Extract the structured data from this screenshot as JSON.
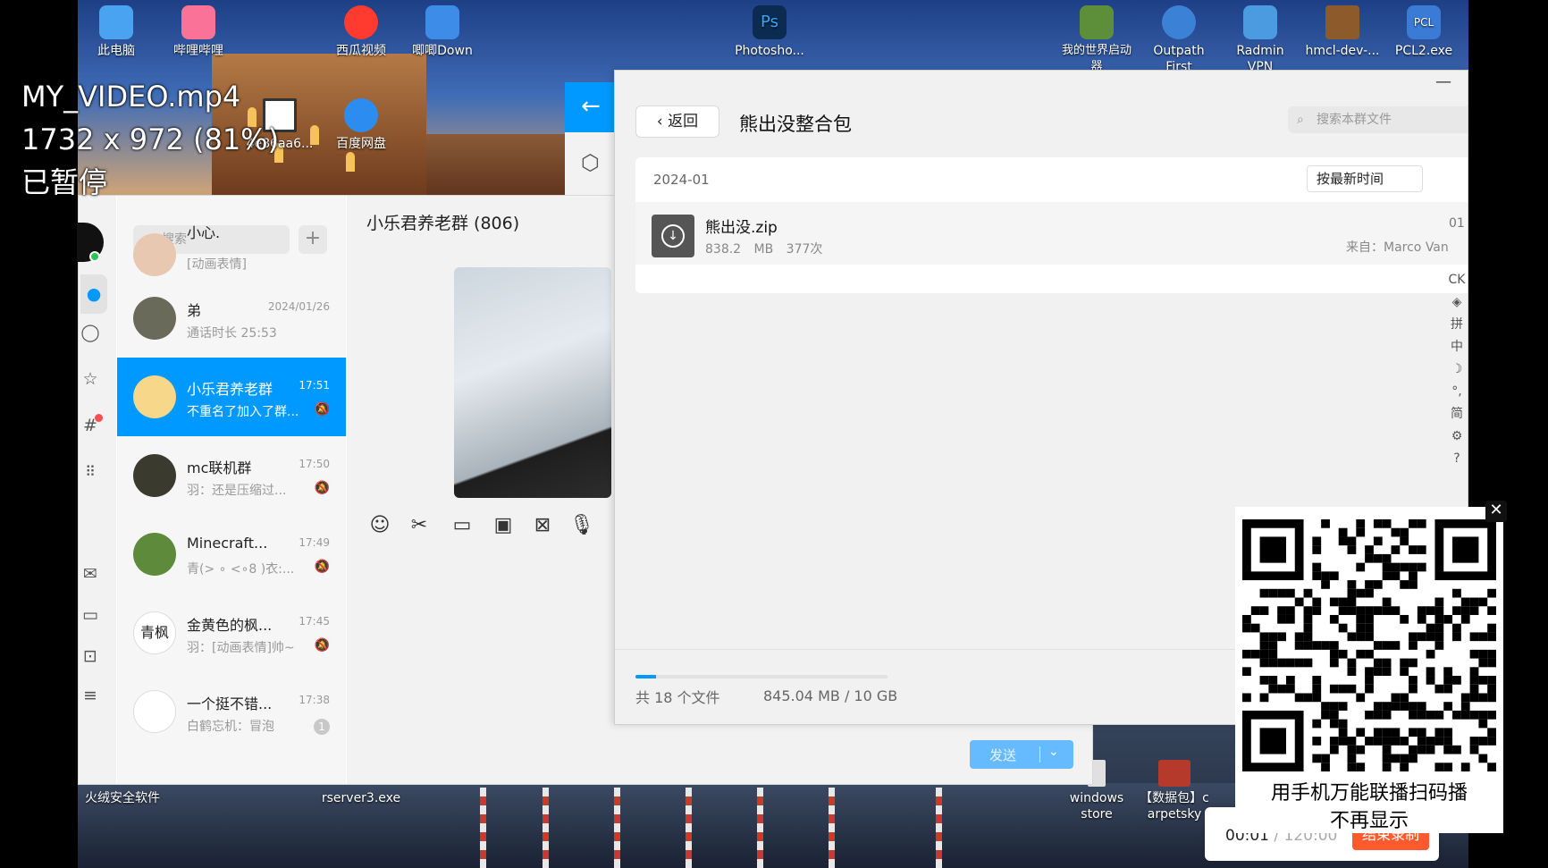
{
  "overlay": {
    "filename": "MY_VIDEO.mp4",
    "resolution": "1732 x 972 (81%)",
    "status": "已暂停"
  },
  "desktop": {
    "icons": [
      {
        "label": "此电脑",
        "color": "#4aa3f0"
      },
      {
        "label": "哔哩哔哩",
        "color": "#fb7299"
      },
      {
        "label": "西瓜视频",
        "color": "#ff3b30"
      },
      {
        "label": "唧唧Down",
        "color": "#3d8de8"
      },
      {
        "label": "Photosho...",
        "color": "#0b2c50"
      },
      {
        "label": "我的世界启动器",
        "color": "#5d8f3a"
      },
      {
        "label": "Outpath First Journey",
        "color": "#3b82d6"
      },
      {
        "label": "Radmin VPN",
        "color": "#4a9be0"
      },
      {
        "label": "hmcl-dev-...",
        "color": "#8d5a2b"
      },
      {
        "label": "PCL2.exe",
        "color": "#3a7bd5"
      },
      {
        "label": "4e86aa6...",
        "color": "#ffffff"
      },
      {
        "label": "百度网盘",
        "color": "#2d8cf0"
      },
      {
        "label": "火绒安全软件",
        "color": "#d2542c"
      },
      {
        "label": "rserver3.exe",
        "color": "#888888"
      },
      {
        "label": "windows store",
        "color": "#e0e0e0"
      },
      {
        "label": "【数据包】carpetsky",
        "color": "#b53a2c"
      }
    ]
  },
  "qq": {
    "search_placeholder": "搜索",
    "add_label": "+",
    "chat_title": "小乐君养老群 (806)",
    "send_label": "发送",
    "side_icons": [
      "chat-icon",
      "contacts-icon",
      "favorite-icon",
      "moments-icon",
      "apps-icon",
      "mail-icon",
      "folder-icon",
      "collection-icon",
      "menu-icon"
    ],
    "chats": [
      {
        "name": "小心.",
        "time": "",
        "msg": "[动画表情]",
        "avatar": "#e8c8b0"
      },
      {
        "name": "弟",
        "time": "2024/01/26",
        "msg": "通话时长 25:53",
        "avatar": "#6a6a5a"
      },
      {
        "name": "小乐君养老群",
        "time": "17:51",
        "msg": "不重名了加入了群...",
        "avatar": "#f7d78a",
        "active": true
      },
      {
        "name": "mc联机群",
        "time": "17:50",
        "msg": "羽：还是压缩过...",
        "avatar": "#3a3a2e"
      },
      {
        "name": "Minecraft...",
        "time": "17:49",
        "msg": "青(> ∘ <∘8 )衣:...",
        "avatar": "#5e8a3c"
      },
      {
        "name": "金黄色的枫...",
        "time": "17:45",
        "msg": "羽：[动画表情]帅~",
        "avatar": "#ffffff"
      },
      {
        "name": "一个挺不错...",
        "time": "17:38",
        "msg": "白鹤忘机：冒泡",
        "avatar": "#ffffff",
        "badge": "1"
      }
    ]
  },
  "filewin": {
    "back_label": "返回",
    "title": "熊出没整合包",
    "search_placeholder": "搜索本群文件",
    "month": "2024-01",
    "sort_label": "按最新时间",
    "file": {
      "name": "熊出没.zip",
      "size": "838.2 MB",
      "downloads": "377次",
      "date": "01",
      "from": "来自：Marco Van"
    },
    "total_files": "共 18 个文件",
    "usage": "845.04 MB / 10 GB",
    "usage_fraction": 0.083,
    "ime_icons": [
      "CK",
      "拼",
      "中",
      "简"
    ]
  },
  "qr": {
    "close_label": "✕",
    "text1": "用手机万能联播扫码播",
    "text2": "不再显示"
  },
  "recording": {
    "elapsed": "00:01",
    "sep": "/",
    "limit": "120:00",
    "end_label": "结束录制"
  }
}
